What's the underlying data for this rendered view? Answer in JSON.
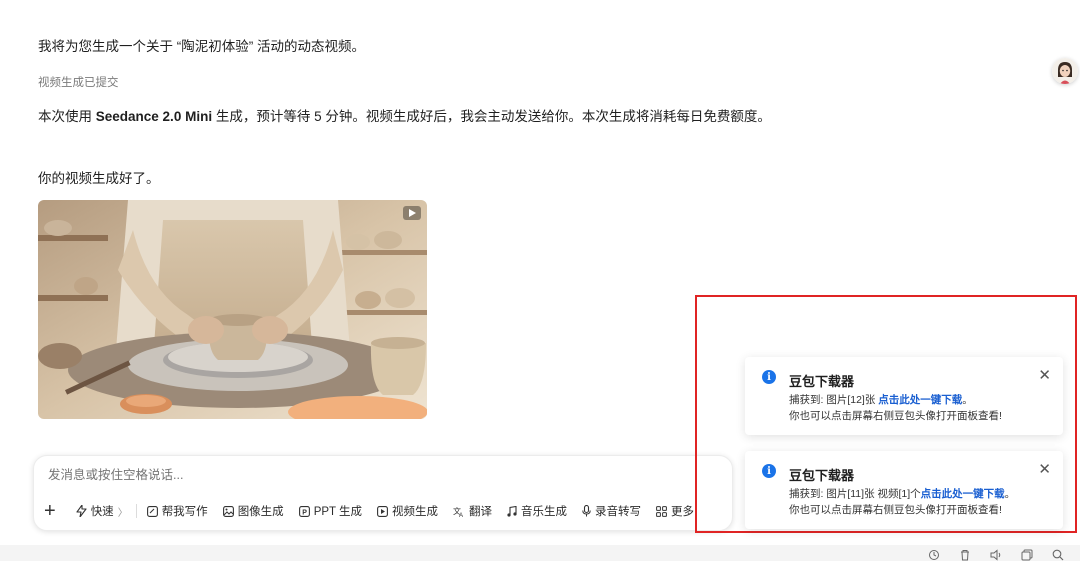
{
  "conversation": {
    "intro": "我将为您生成一个关于 “陶泥初体验” 活动的动态视频。",
    "status": "视频生成已提交",
    "detail_prefix": "本次使用 ",
    "detail_model": "Seedance 2.0 Mini",
    "detail_suffix": " 生成，预计等待 5 分钟。视频生成好后，我会主动发送给你。本次生成将消耗每日免费额度。",
    "done": "你的视频生成好了。"
  },
  "composer": {
    "placeholder": "发消息或按住空格说话...",
    "tools": [
      {
        "label": "快速",
        "icon": "lightning-icon"
      },
      {
        "label": "帮我写作",
        "icon": "write-icon"
      },
      {
        "label": "图像生成",
        "icon": "image-icon"
      },
      {
        "label": "PPT 生成",
        "icon": "ppt-icon"
      },
      {
        "label": "视频生成",
        "icon": "video-icon"
      },
      {
        "label": "翻译",
        "icon": "translate-icon"
      },
      {
        "label": "音乐生成",
        "icon": "music-icon"
      },
      {
        "label": "录音转写",
        "icon": "microphone-icon"
      },
      {
        "label": "更多",
        "icon": "grid-icon"
      }
    ]
  },
  "toasts": [
    {
      "title": "豆包下载器",
      "line1_prefix": "捕获到: 图片[12]张 ",
      "line1_link": "点击此处一键下载",
      "line1_suffix": "。",
      "line2": "你也可以点击屏幕右侧豆包头像打开面板查看!"
    },
    {
      "title": "豆包下载器",
      "line1_prefix": "捕获到: 图片[11]张 视频[1]个",
      "line1_link": "点击此处一键下载",
      "line1_suffix": "。",
      "line2": "你也可以点击屏幕右侧豆包头像打开面板查看!"
    }
  ],
  "colors": {
    "accent": "#1a73e8",
    "link": "#1a5fd1",
    "highlight": "#e02424"
  }
}
